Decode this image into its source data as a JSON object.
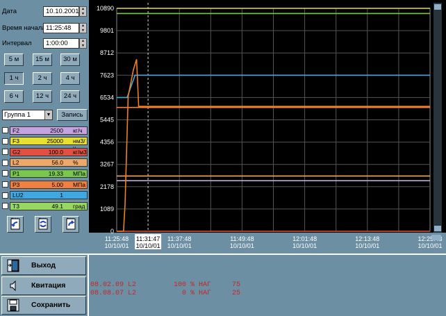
{
  "fields": {
    "date_label": "Дата",
    "date_value": "10.10.2001",
    "start_label": "Время начала",
    "start_value": "11:25:48",
    "interval_label": "Интервал",
    "interval_value": "1:00:00"
  },
  "time_buttons": [
    {
      "label": "5 м",
      "active": false
    },
    {
      "label": "15 м",
      "active": false
    },
    {
      "label": "30 м",
      "active": false
    },
    {
      "label": "1 ч",
      "active": true
    },
    {
      "label": "2 ч",
      "active": false
    },
    {
      "label": "4 ч",
      "active": false
    },
    {
      "label": "6 ч",
      "active": false
    },
    {
      "label": "12 ч",
      "active": false
    },
    {
      "label": "24 ч",
      "active": false
    }
  ],
  "group": {
    "selected": "Группа 1",
    "record_label": "Запись"
  },
  "params": [
    {
      "name": "F2",
      "value": "2500",
      "unit": "кг/ч",
      "color": "#c5a3e0"
    },
    {
      "name": "F3",
      "value": "25000",
      "unit": "нм3/ч",
      "color": "#e8e030"
    },
    {
      "name": "G2",
      "value": "100.0",
      "unit": "кг/м3",
      "color": "#e25040"
    },
    {
      "name": "L2",
      "value": "56.0",
      "unit": "%",
      "color": "#f0a868"
    },
    {
      "name": "P1",
      "value": "19.33",
      "unit": "МПа",
      "color": "#78c84e"
    },
    {
      "name": "P3",
      "value": "5.00",
      "unit": "МПа",
      "color": "#f08040"
    },
    {
      "name": "LU2",
      "value": "1",
      "unit": "",
      "color": "#40a8e0"
    },
    {
      "name": "T3",
      "value": "49.1",
      "unit": "град",
      "color": "#98d860"
    }
  ],
  "bottom_buttons": [
    {
      "label": "Выход",
      "icon": "exit-door-icon"
    },
    {
      "label": "Квитация",
      "icon": "speaker-icon"
    },
    {
      "label": "Сохранить",
      "icon": "floppy-disk-icon"
    }
  ],
  "alarms": [
    "08.02.09 L2         100 % НАГ     75",
    "08.08.07 L2           0 % НАГ     25"
  ],
  "colors": {
    "background": "#6d8fa3",
    "chart_bg": "#000000",
    "grid": "#555555",
    "alarm_text": "#c0282a"
  },
  "chart_data": {
    "type": "line",
    "y_ticks": [
      "0",
      "1089",
      "2178",
      "3267",
      "4356",
      "5445",
      "6534",
      "7623",
      "8712",
      "9801",
      "10890"
    ],
    "ylim": [
      0,
      10890
    ],
    "x_ticks": [
      {
        "time": "11:25:48",
        "date": "10/10/01"
      },
      {
        "time": "11:31:47",
        "date": "10/10/01",
        "cursor": true
      },
      {
        "time": "11:37:48",
        "date": "10/10/01"
      },
      {
        "time": "11:49:48",
        "date": "10/10/01"
      },
      {
        "time": "12:01:48",
        "date": "10/10/01"
      },
      {
        "time": "12:13:48",
        "date": "10/10/01"
      },
      {
        "time": "12:25:48",
        "date": "10/10/01"
      }
    ],
    "xlim_minutes": [
      0,
      60
    ],
    "cursor_minute": 6,
    "grid": true,
    "series": [
      {
        "color": "#e8e030",
        "points": [
          [
            0,
            10890
          ],
          [
            60,
            10890
          ]
        ]
      },
      {
        "color": "#78c84e",
        "points": [
          [
            0,
            10640
          ],
          [
            60,
            10640
          ]
        ]
      },
      {
        "color": "#40a8e0",
        "points": [
          [
            0,
            6534
          ],
          [
            2,
            6534
          ],
          [
            3.5,
            7623
          ],
          [
            60,
            7623
          ]
        ]
      },
      {
        "color": "#f08040",
        "points": [
          [
            0,
            6050
          ],
          [
            60,
            6050
          ]
        ]
      },
      {
        "color": "#f0a868",
        "points": [
          [
            0,
            2700
          ],
          [
            60,
            2700
          ]
        ]
      },
      {
        "color": "#c5a3e0",
        "points": [
          [
            0,
            2470
          ],
          [
            60,
            2470
          ]
        ]
      },
      {
        "color": "#e25040",
        "points": [
          [
            0,
            0
          ],
          [
            60,
            0
          ]
        ]
      },
      {
        "color": "#f08020",
        "points": [
          [
            0,
            0
          ],
          [
            1.3,
            0
          ],
          [
            1.6,
            1300
          ],
          [
            2.2,
            6600
          ],
          [
            3.2,
            7900
          ],
          [
            3.8,
            8400
          ],
          [
            4.2,
            6100
          ],
          [
            60,
            6100
          ]
        ]
      }
    ]
  }
}
